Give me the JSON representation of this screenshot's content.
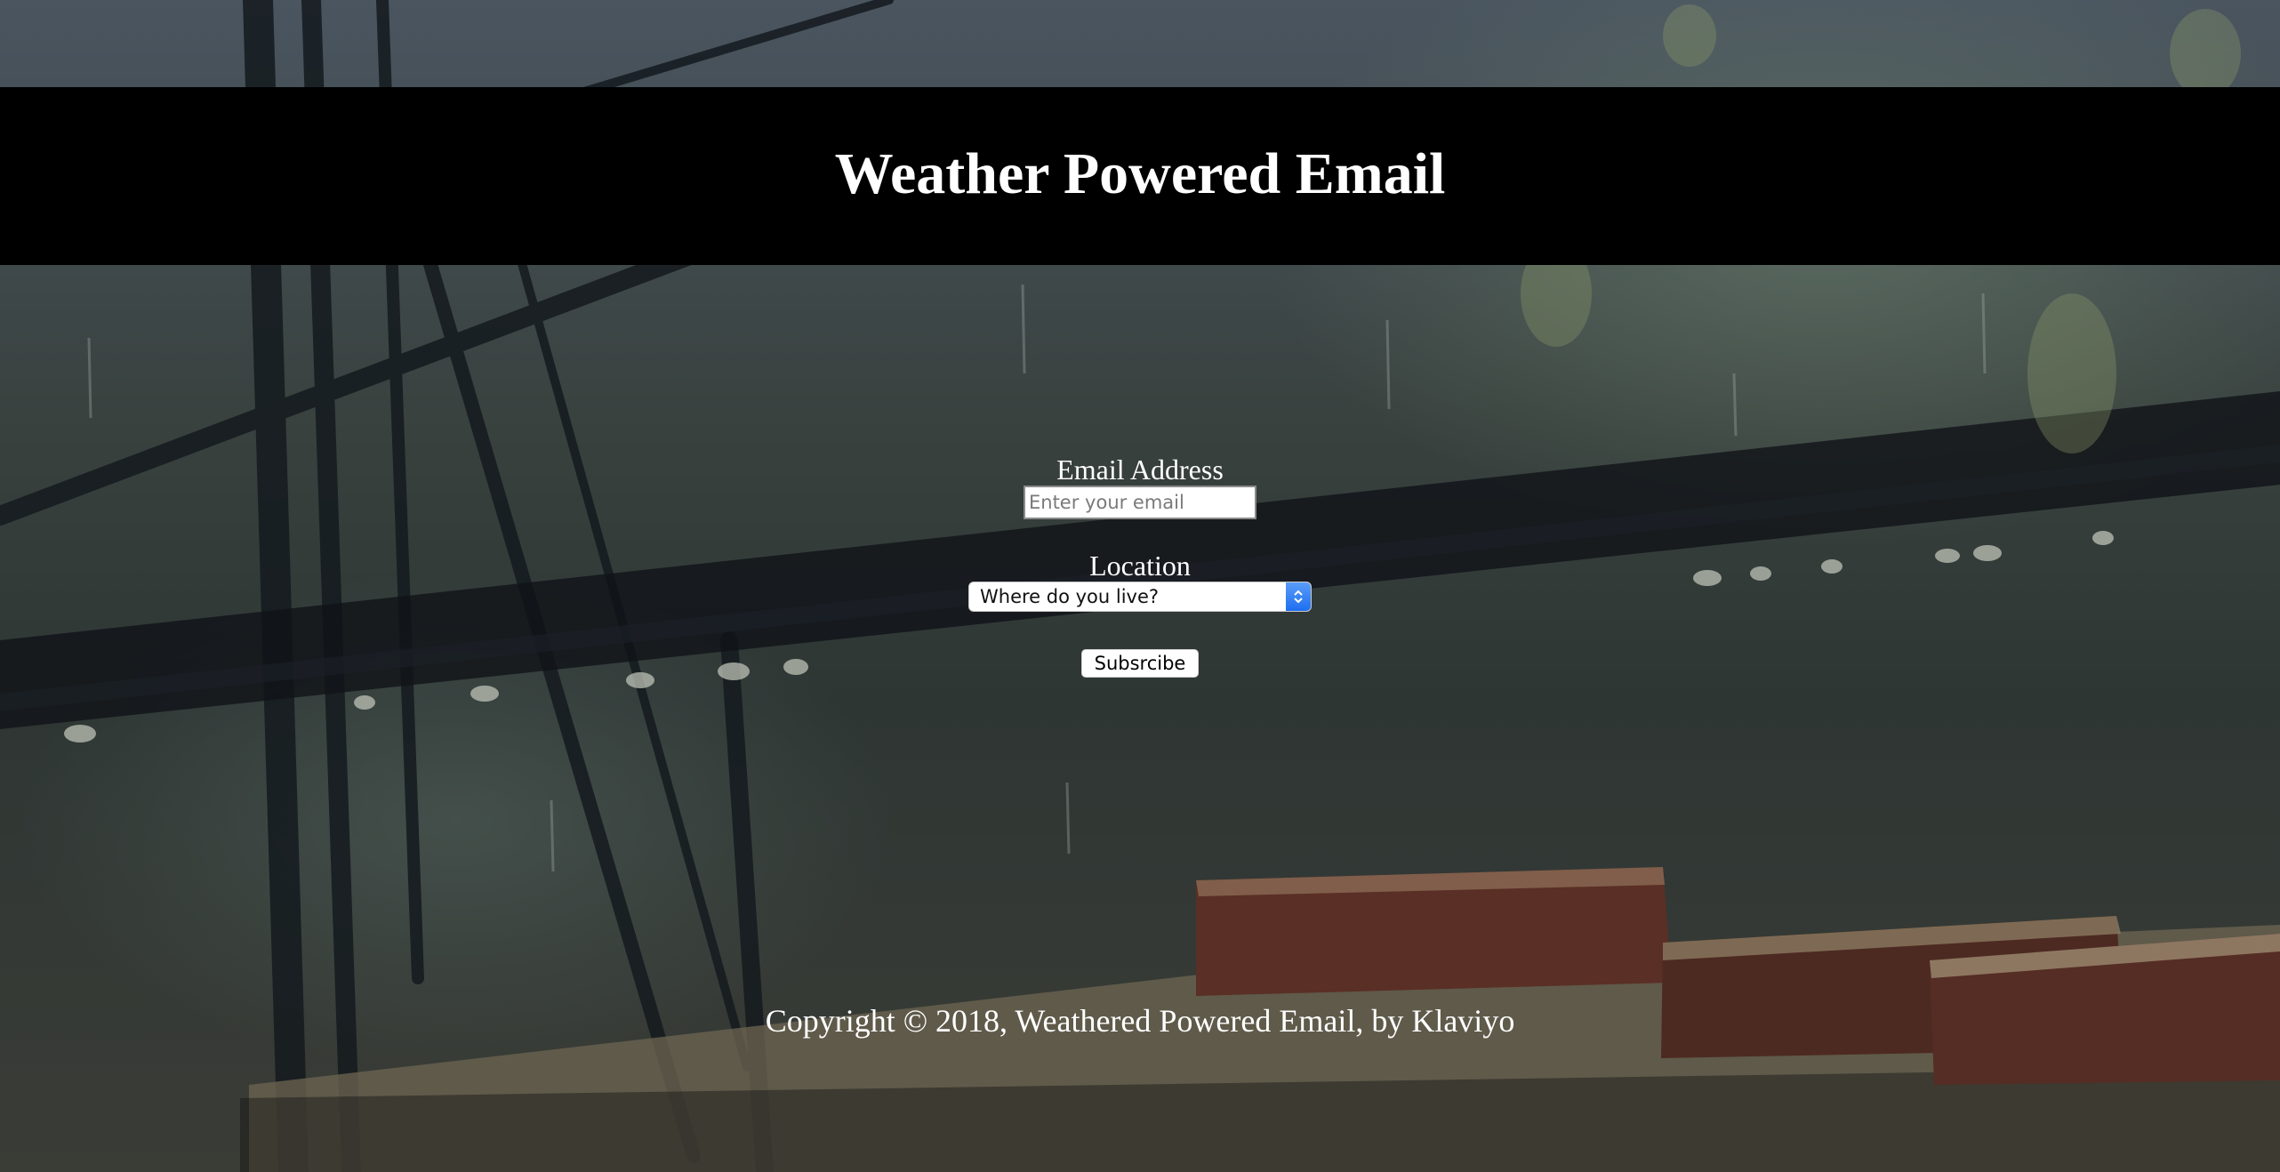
{
  "header": {
    "title": "Weather Powered Email"
  },
  "form": {
    "email": {
      "label": "Email Address",
      "placeholder": "Enter your email",
      "value": ""
    },
    "location": {
      "label": "Location",
      "selected": "Where do you live?"
    },
    "subscribe_label": "Subsrcibe"
  },
  "footer": {
    "copyright": "Copyright © 2018, Weathered Powered Email, by Klaviyo"
  },
  "colors": {
    "header_bg": "#000000",
    "text": "#ffffff",
    "select_accent": "#1d6ff0"
  },
  "background": {
    "description_icon": "rainy-scene-background"
  }
}
